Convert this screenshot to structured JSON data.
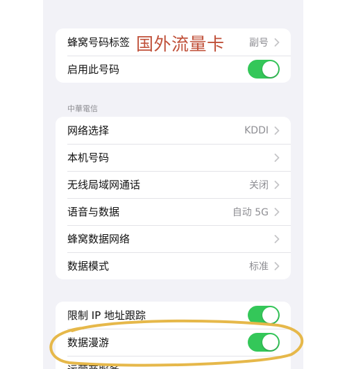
{
  "group1": {
    "cellular_label": {
      "label": "蜂窝号码标签",
      "value": "副号"
    },
    "enable_number": {
      "label": "启用此号码",
      "toggle": true
    }
  },
  "annotation": {
    "text": "国外流量卡",
    "color": "#c0513a"
  },
  "carrier_section": {
    "header": "中華電信",
    "rows": [
      {
        "label": "网络选择",
        "value": "KDDI"
      },
      {
        "label": "本机号码",
        "value": ""
      },
      {
        "label": "无线局域网通话",
        "value": "关闭"
      },
      {
        "label": "语音与数据",
        "value": "自动 5G"
      },
      {
        "label": "蜂窝数据网络",
        "value": ""
      },
      {
        "label": "数据模式",
        "value": "标准"
      }
    ]
  },
  "group3": {
    "limit_ip": {
      "label": "限制 IP 地址跟踪",
      "toggle": true
    },
    "data_roaming": {
      "label": "数据漫游",
      "toggle": true
    },
    "carrier_services": {
      "label": "运营商服务"
    }
  },
  "colors": {
    "toggle_on": "#34c759",
    "highlight_circle": "#e6b84a"
  }
}
